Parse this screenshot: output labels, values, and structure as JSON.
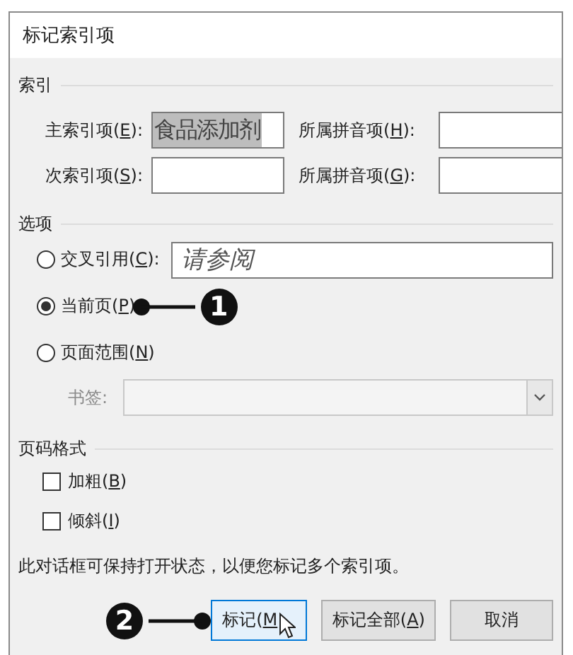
{
  "window": {
    "title": "标记索引项"
  },
  "index_section": {
    "title": "索引",
    "fields": [
      {
        "before": "主索引项(",
        "key": "E",
        "after": "):",
        "value": "食品添加剂",
        "text_selected": true
      },
      {
        "before": "所属拼音项(",
        "key": "H",
        "after": "):"
      },
      {
        "before": "次索引项(",
        "key": "S",
        "after": "):"
      },
      {
        "before": "所属拼音项(",
        "key": "G",
        "after": "):"
      }
    ]
  },
  "options_section": {
    "title": "选项",
    "radios": [
      {
        "before": "交叉引用(",
        "key": "C",
        "after": "):",
        "selected": false,
        "field_value": "请参阅"
      },
      {
        "before": "当前页(",
        "key": "P",
        "after": ")",
        "selected": true,
        "callout": "1"
      },
      {
        "before": "页面范围(",
        "key": "N",
        "after": ")",
        "selected": false
      }
    ],
    "bookmark": {
      "label": "书签:",
      "disabled": true
    }
  },
  "format_section": {
    "title": "页码格式",
    "checkboxes": [
      {
        "before": "加粗(",
        "key": "B",
        "after": ")",
        "checked": false
      },
      {
        "before": "倾斜(",
        "key": "I",
        "after": ")",
        "checked": false
      }
    ]
  },
  "note": "此对话框可保持打开状态，以便您标记多个索引项。",
  "buttons": [
    {
      "before": "标记(",
      "key": "M",
      "focused": true,
      "callout": "2",
      "pointer": true
    },
    {
      "before": "标记全部(",
      "key": "A",
      "after": ")",
      "focused": false
    },
    {
      "label": "取消",
      "focused": false
    }
  ]
}
